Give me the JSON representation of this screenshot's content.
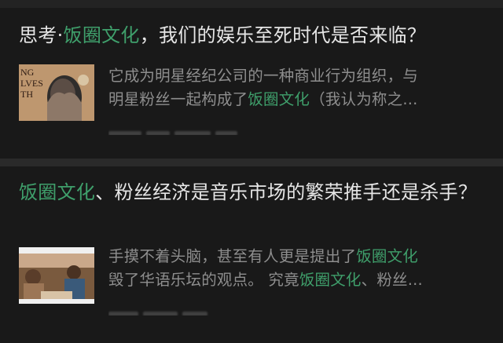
{
  "feed": {
    "articles": [
      {
        "title_prefix": "思考·",
        "title_keyword": "饭圈文化",
        "title_suffix": "，我们的娱乐至死时代是否来临？",
        "excerpt_line1": "它成为明星经纪公司的一种商业行为组织，与",
        "excerpt_line2_prefix": "明星粉丝一起构成了",
        "excerpt_keyword": "饭圈文化",
        "excerpt_line2_suffix": "（我认为称之...",
        "thumbnail_text": "NG\nLVES\nTH"
      },
      {
        "title_keyword": "饭圈文化",
        "title_suffix": "、粉丝经济是音乐市场的繁荣推手还是杀手？",
        "excerpt_line1_prefix": "手摸不着头脑，甚至有人更是提出了",
        "excerpt_keyword1": "饭圈文化",
        "excerpt_line2_prefix": "毁了华语乐坛的观点。 究竟",
        "excerpt_keyword2": "饭圈文化",
        "excerpt_line2_suffix": "、粉丝..."
      }
    ]
  },
  "colors": {
    "background": "#191919",
    "separator": "#2a2a2a",
    "title_text": "#e6e6e6",
    "excerpt_text": "#8e8e8e",
    "keyword_highlight": "#3f9f6b"
  }
}
